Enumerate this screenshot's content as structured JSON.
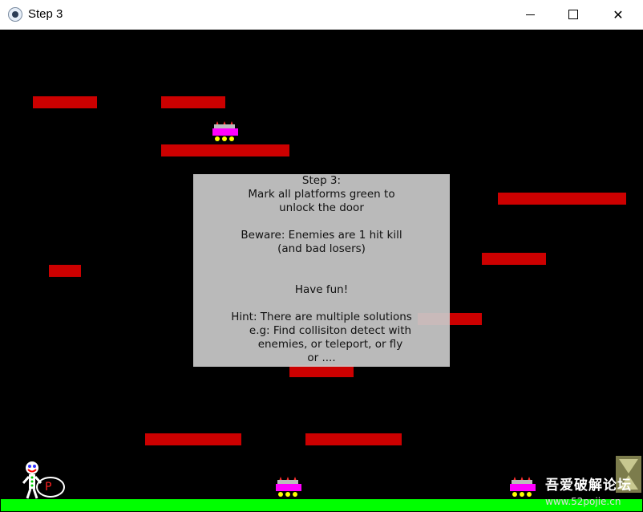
{
  "window": {
    "title": "Step 3",
    "icon": "paw-icon",
    "controls": {
      "minimize": "minimize-icon",
      "maximize": "maximize-icon",
      "close": "close-icon"
    }
  },
  "game": {
    "platform_color": "#cc0000",
    "ground_color": "#00ff00",
    "background": "#000000",
    "overlay": {
      "lines": [
        "Step 3:",
        "Mark all platforms green to",
        "unlock the door",
        "",
        "Beware: Enemies are 1 hit kill",
        "(and bad losers)",
        "",
        "",
        "Have fun!",
        "",
        "Hint: There are multiple solutions",
        "e.g: Find collisiton detect with",
        "enemies, or teleport, or fly",
        "or ...."
      ]
    },
    "player": {
      "badge": "P"
    }
  },
  "watermark": {
    "main": "吾爱破解论坛",
    "url": "www.52pojie.cn"
  }
}
